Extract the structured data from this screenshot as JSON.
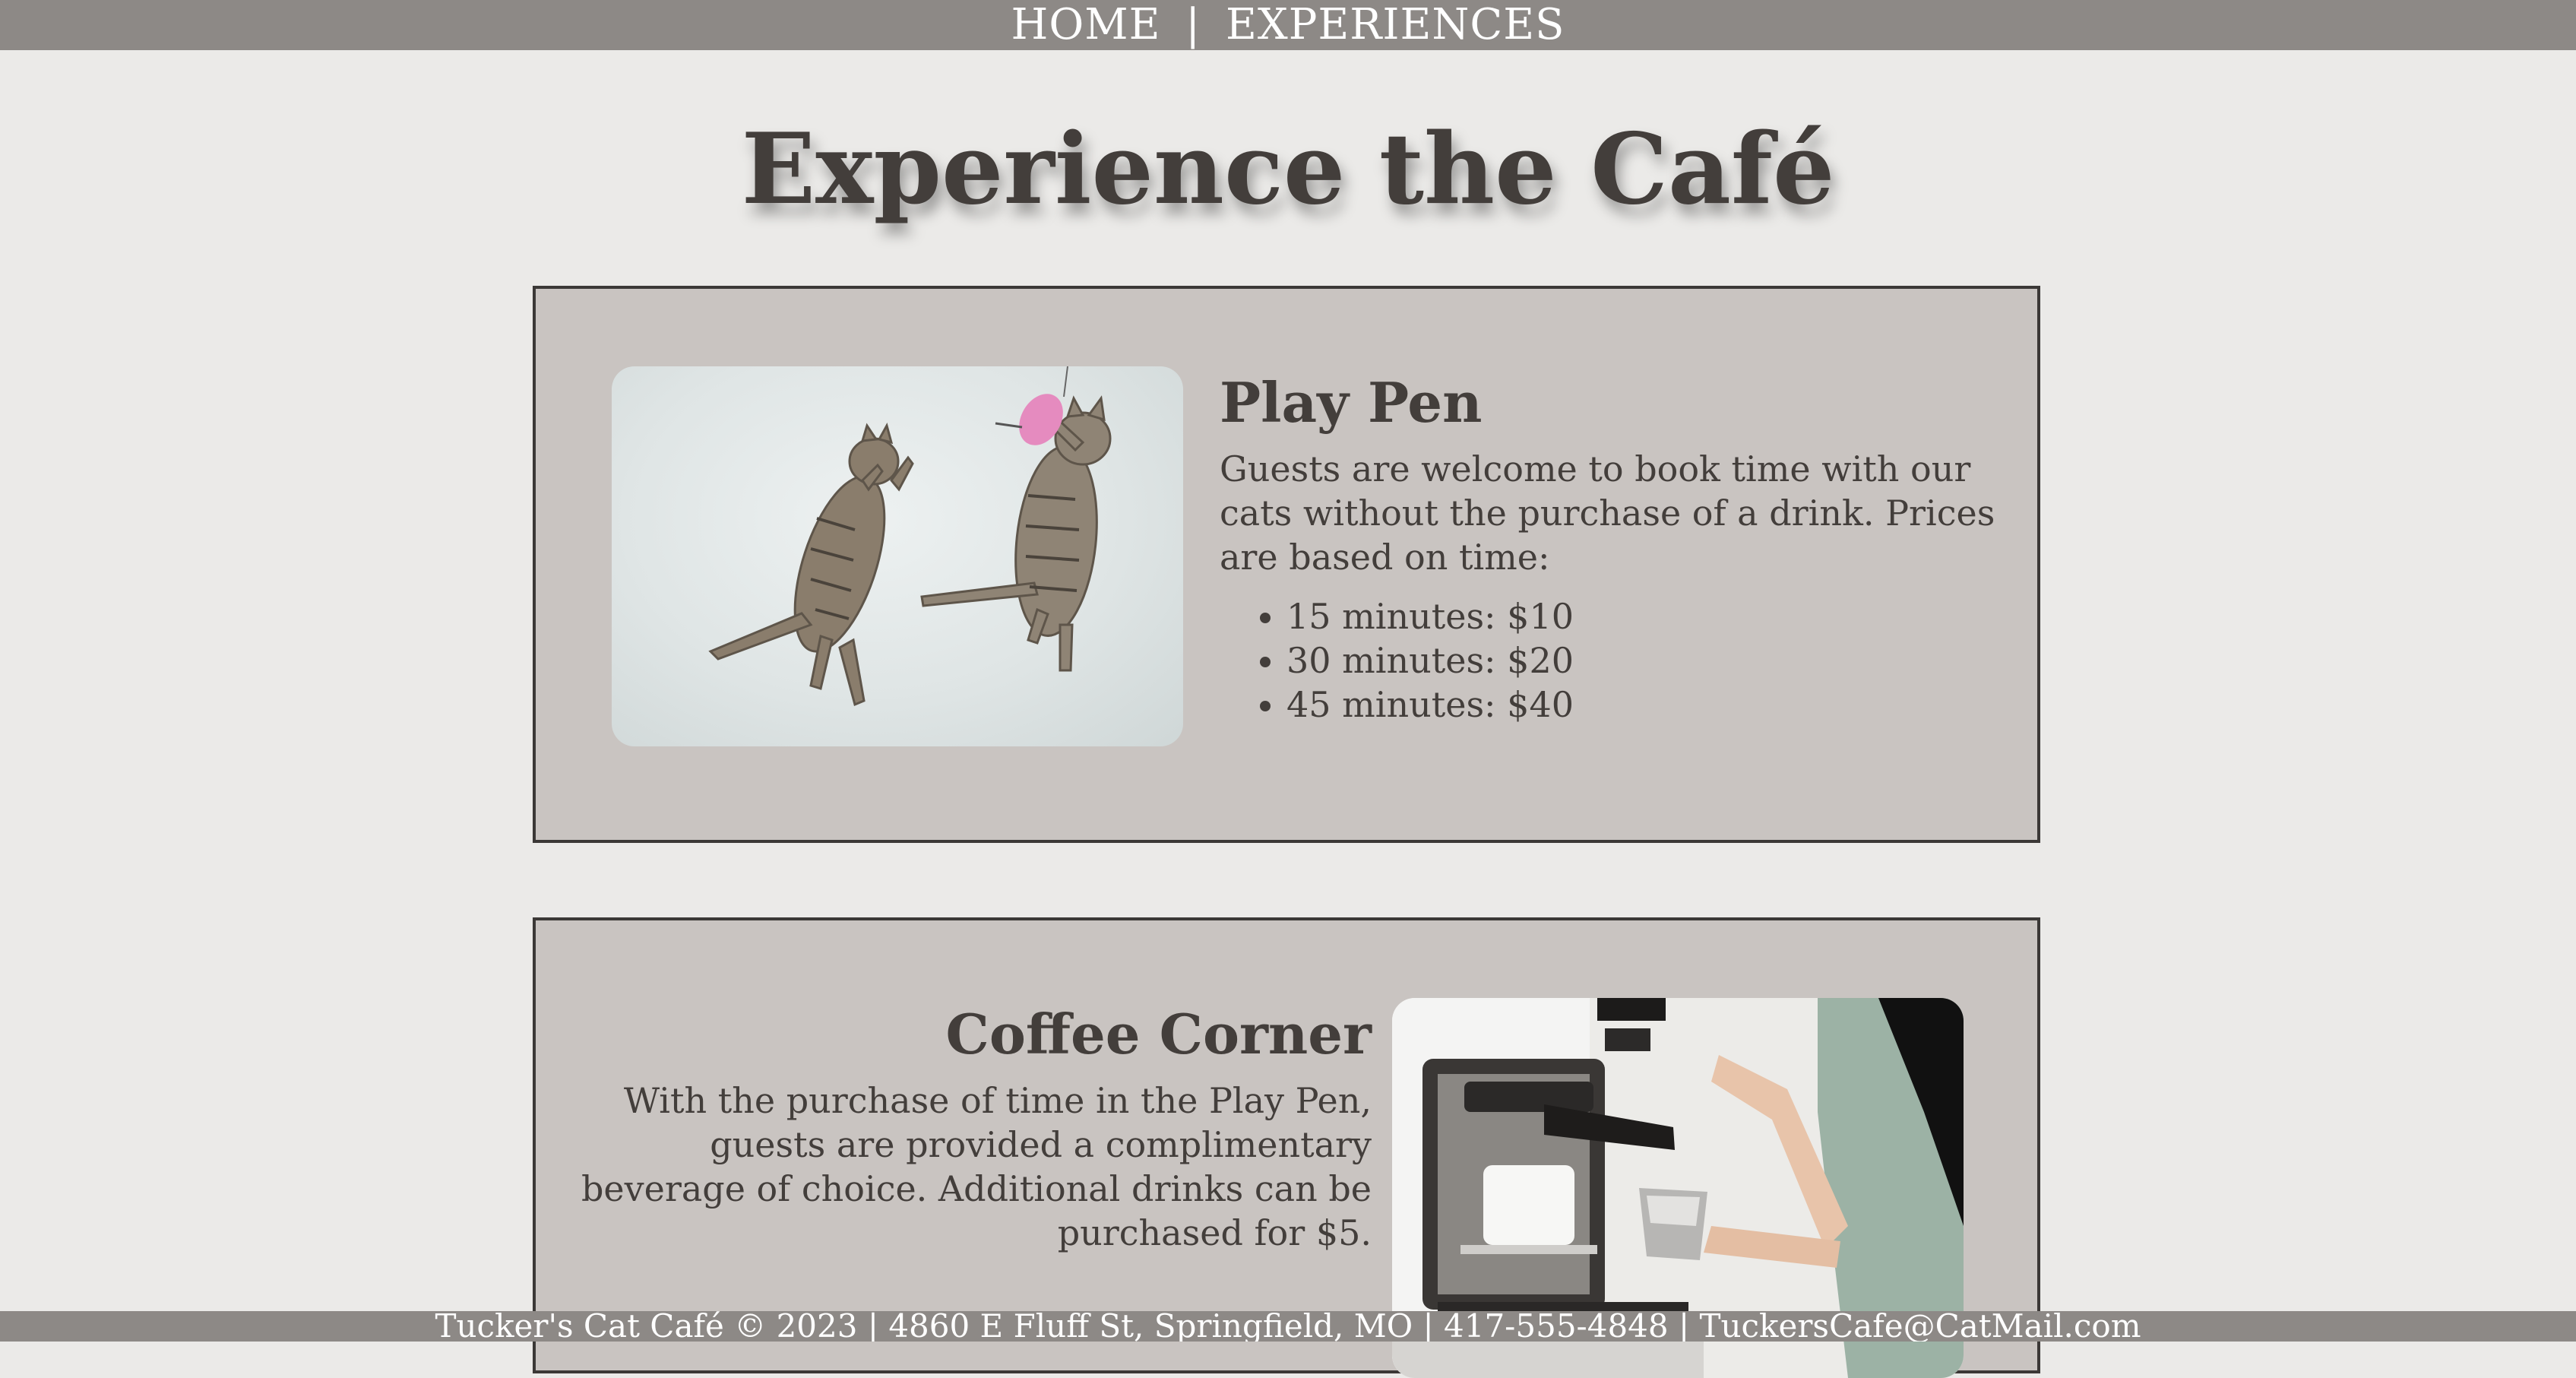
{
  "nav": {
    "home_label": "HOME",
    "separator": "|",
    "experiences_label": "EXPERIENCES"
  },
  "page": {
    "title": "Experience the Café"
  },
  "play_pen": {
    "heading": "Play Pen",
    "description": "Guests are welcome to book time with our cats without the purchase of a drink. Prices are based on time:",
    "prices": [
      "15 minutes: $10",
      "30 minutes: $20",
      "45 minutes: $40"
    ],
    "image_icon": "two-cats-jumping-photo"
  },
  "coffee_corner": {
    "heading": "Coffee Corner",
    "description": "With the purchase of time in the Play Pen, guests are provided a complimentary beverage of choice. Additional drinks can be purchased for $5.",
    "image_icon": "barista-espresso-machine-photo"
  },
  "footer": {
    "text": "Tucker's Cat Café © 2023 | 4860 E Fluff St, Springfield, MO | 417-555-4848 | TuckersCafe@CatMail.com"
  },
  "colors": {
    "background": "#ebeae8",
    "nav_bar": "#8d8986",
    "card_bg": "#c9c4c1",
    "card_border": "#3b3836",
    "text": "#433e3b"
  }
}
